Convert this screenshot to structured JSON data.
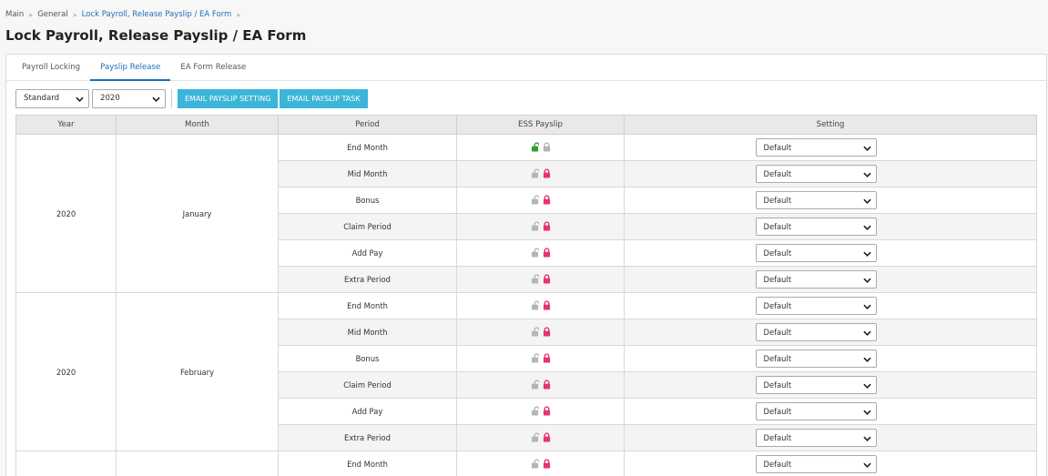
{
  "breadcrumb": {
    "items": [
      {
        "label": "Main",
        "link": false
      },
      {
        "label": "General",
        "link": false
      },
      {
        "label": "Lock Payroll, Release Payslip / EA Form",
        "link": true
      }
    ],
    "separator": "»"
  },
  "page": {
    "title": "Lock Payroll, Release Payslip / EA Form"
  },
  "tabs": [
    {
      "label": "Payroll Locking",
      "active": false
    },
    {
      "label": "Payslip Release",
      "active": true
    },
    {
      "label": "EA Form Release",
      "active": false
    }
  ],
  "toolbar": {
    "type_select": "Standard",
    "year_select": "2020",
    "email_setting_label": "EMAIL PAYSLIP SETTING",
    "email_task_label": "EMAIL PAYSLIP TASK"
  },
  "table": {
    "headers": {
      "year": "Year",
      "month": "Month",
      "period": "Period",
      "ess": "ESS Payslip",
      "setting": "Setting"
    },
    "groups": [
      {
        "year": "2020",
        "month": "January",
        "rows": [
          {
            "period": "End Month",
            "unlocked": true,
            "setting": "Default"
          },
          {
            "period": "Mid Month",
            "unlocked": false,
            "setting": "Default"
          },
          {
            "period": "Bonus",
            "unlocked": false,
            "setting": "Default"
          },
          {
            "period": "Claim Period",
            "unlocked": false,
            "setting": "Default"
          },
          {
            "period": "Add Pay",
            "unlocked": false,
            "setting": "Default"
          },
          {
            "period": "Extra Period",
            "unlocked": false,
            "setting": "Default"
          }
        ]
      },
      {
        "year": "2020",
        "month": "February",
        "rows": [
          {
            "period": "End Month",
            "unlocked": false,
            "setting": "Default"
          },
          {
            "period": "Mid Month",
            "unlocked": false,
            "setting": "Default"
          },
          {
            "period": "Bonus",
            "unlocked": false,
            "setting": "Default"
          },
          {
            "period": "Claim Period",
            "unlocked": false,
            "setting": "Default"
          },
          {
            "period": "Add Pay",
            "unlocked": false,
            "setting": "Default"
          },
          {
            "period": "Extra Period",
            "unlocked": false,
            "setting": "Default"
          }
        ]
      },
      {
        "year": "",
        "month": "",
        "rows": [
          {
            "period": "End Month",
            "unlocked": false,
            "setting": "Default"
          }
        ]
      }
    ]
  },
  "colors": {
    "accent": "#1f6fb5",
    "button": "#3bb5d8",
    "unlock_active": "#2e9e2e",
    "lock_active": "#e8336f",
    "icon_inactive": "#b5b5b5"
  },
  "icons": {
    "unlock": "unlock-icon",
    "lock": "lock-icon",
    "dropdown": "chevron-down-icon"
  }
}
